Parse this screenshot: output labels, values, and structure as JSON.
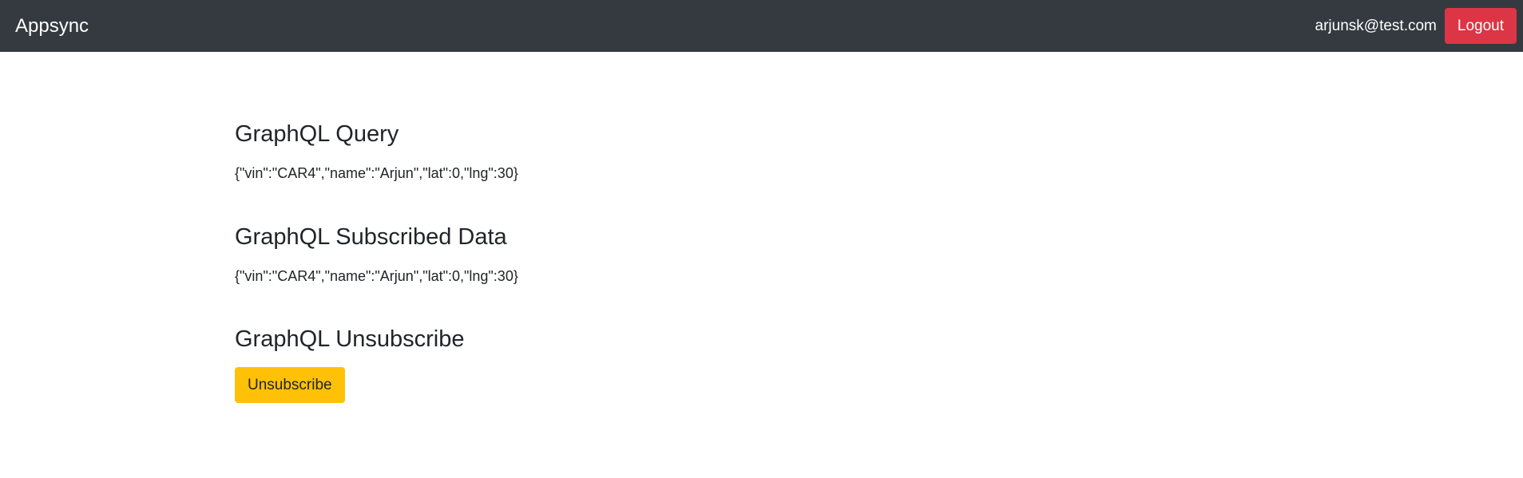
{
  "navbar": {
    "brand": "Appsync",
    "user_email": "arjunsk@test.com",
    "logout_label": "Logout",
    "background_color": "#343a40",
    "logout_color": "#dc3545"
  },
  "main": {
    "query": {
      "title": "GraphQL Query",
      "data": "{\"vin\":\"CAR4\",\"name\":\"Arjun\",\"lat\":0,\"lng\":30}"
    },
    "subscribed": {
      "title": "GraphQL Subscribed Data",
      "data": "{\"vin\":\"CAR4\",\"name\":\"Arjun\",\"lat\":0,\"lng\":30}"
    },
    "unsubscribe": {
      "title": "GraphQL Unsubscribe",
      "button_label": "Unsubscribe",
      "button_color": "#ffc107"
    }
  }
}
